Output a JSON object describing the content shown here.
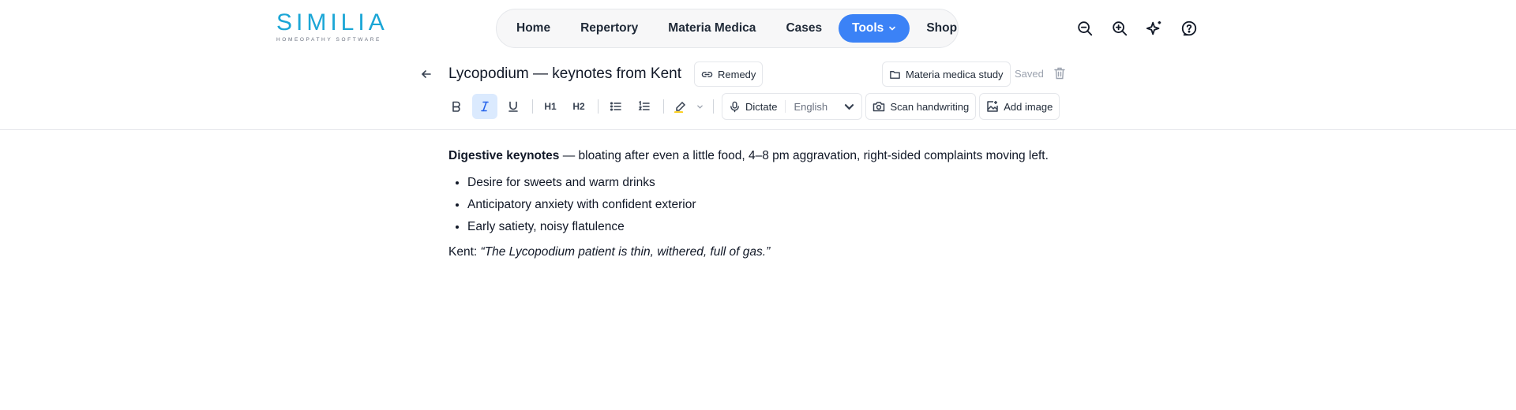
{
  "app": {
    "logo_text": "SIMILIA",
    "logo_subtitle": "HOMEOPATHY SOFTWARE"
  },
  "nav": {
    "items": [
      {
        "label": "Home"
      },
      {
        "label": "Repertory"
      },
      {
        "label": "Materia Medica"
      },
      {
        "label": "Cases"
      },
      {
        "label": "Tools",
        "active": true
      },
      {
        "label": "Shop"
      }
    ],
    "right_icons": [
      "zoom-out-icon",
      "zoom-in-icon",
      "sparkles-icon",
      "help-icon"
    ]
  },
  "note": {
    "title": "Lycopodium — keynotes from Kent",
    "remedy_chip": "Remedy",
    "folder": "Materia medica study",
    "status": "Saved"
  },
  "toolbar": {
    "h1": "H1",
    "h2": "H2",
    "dictate_label": "Dictate",
    "language": "English",
    "scan_label": "Scan handwriting",
    "image_label": "Add image",
    "active_format": "italic",
    "highlight_color": "#facc15"
  },
  "content": {
    "p1_bold": "Digestive keynotes",
    "p1_rest": " — bloating after even a little food, 4–8 pm aggravation, right-sided complaints moving left.",
    "bullets": [
      "Desire for sweets and warm drinks",
      "Anticipatory anxiety with confident exterior",
      "Early satiety, noisy flatulence"
    ],
    "quote_prefix": "Kent: ",
    "quote_text": "“The Lycopodium patient is thin, withered, full of gas.”"
  },
  "colors": {
    "accent": "#3b82f6",
    "logo": "#1ba6d6"
  }
}
